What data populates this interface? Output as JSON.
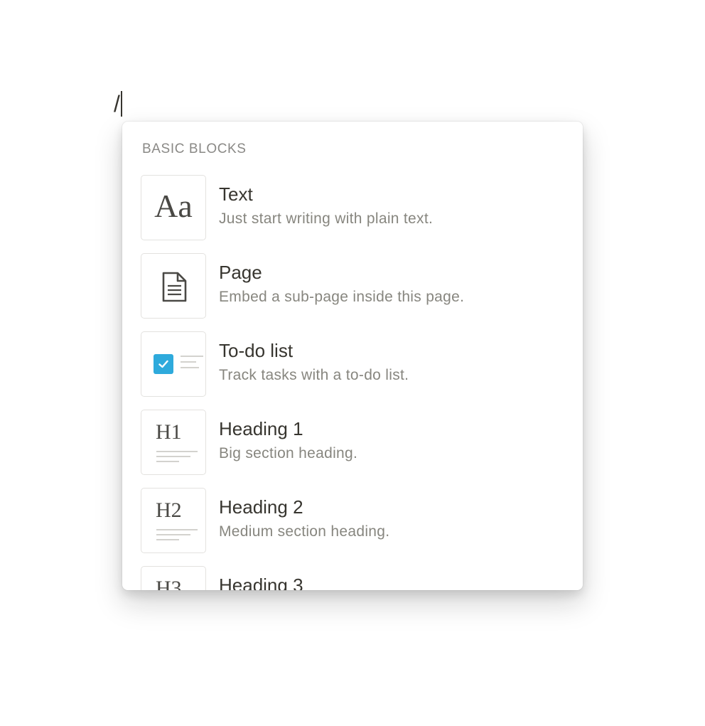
{
  "editor": {
    "typed_text": "/"
  },
  "menu": {
    "section_header": "BASIC BLOCKS",
    "items": [
      {
        "title": "Text",
        "description": "Just start writing with plain text.",
        "icon": "text-aa-icon",
        "glyph": "Aa"
      },
      {
        "title": "Page",
        "description": "Embed a sub-page inside this page.",
        "icon": "page-document-icon"
      },
      {
        "title": "To-do list",
        "description": "Track tasks with a to-do list.",
        "icon": "todo-checkbox-icon"
      },
      {
        "title": "Heading 1",
        "description": "Big section heading.",
        "icon": "heading-1-icon",
        "glyph": "H1"
      },
      {
        "title": "Heading 2",
        "description": "Medium section heading.",
        "icon": "heading-2-icon",
        "glyph": "H2"
      },
      {
        "title": "Heading 3",
        "description": "",
        "icon": "heading-3-icon",
        "glyph": "H3"
      }
    ]
  },
  "colors": {
    "text_primary": "#37352f",
    "text_secondary": "#87867f",
    "checkbox_blue": "#2eaadc"
  }
}
